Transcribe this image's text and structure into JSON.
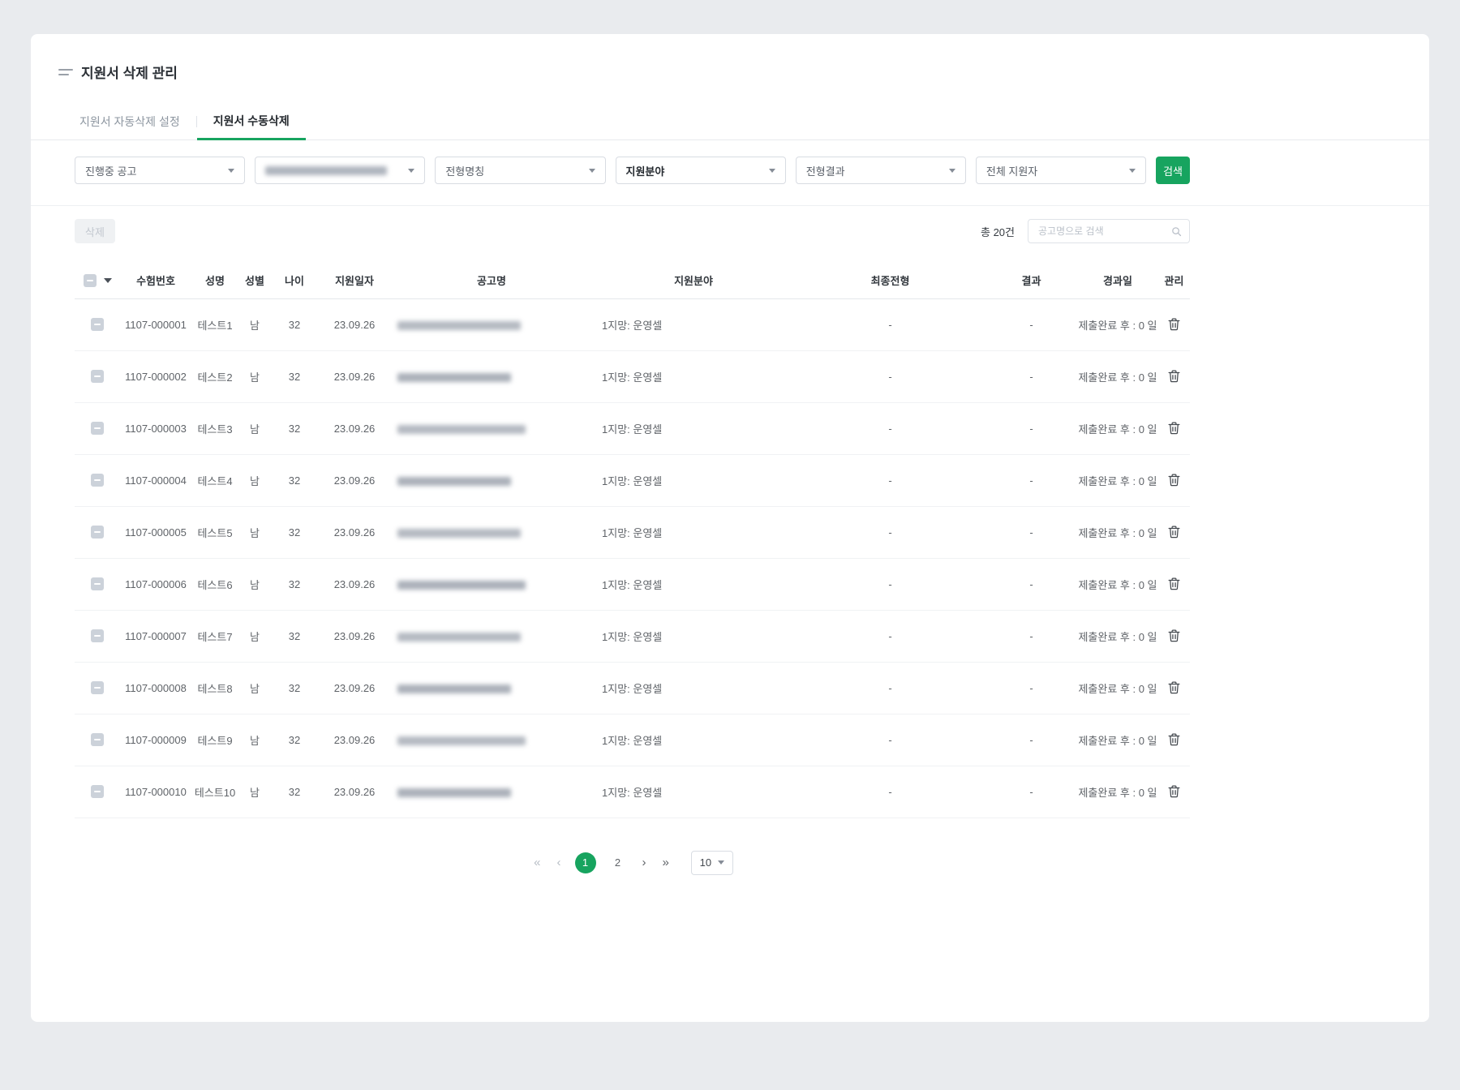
{
  "colors": {
    "accent_green": "#17a45f"
  },
  "page": {
    "title": "지원서 삭제 관리"
  },
  "tabs": [
    {
      "label": "지원서 자동삭제 설정"
    },
    {
      "label": "지원서 수동삭제"
    }
  ],
  "active_tab": 1,
  "filters": {
    "dropdowns": [
      {
        "value": "진행중 공고",
        "redacted": false,
        "emphasized": false
      },
      {
        "value": "",
        "redacted": true,
        "emphasized": false
      },
      {
        "value": "전형명칭",
        "redacted": false,
        "emphasized": false
      },
      {
        "value": "지원분야",
        "redacted": false,
        "emphasized": true
      },
      {
        "value": "전형결과",
        "redacted": false,
        "emphasized": false
      },
      {
        "value": "전체 지원자",
        "redacted": false,
        "emphasized": false
      }
    ],
    "search_button": "검색"
  },
  "toolbar": {
    "delete_button": "삭제",
    "total_label": "총 20건",
    "search_placeholder": "공고명으로 검색"
  },
  "table": {
    "columns": [
      {
        "key": "exam_no",
        "label": "수험번호"
      },
      {
        "key": "name",
        "label": "성명"
      },
      {
        "key": "gender",
        "label": "성별"
      },
      {
        "key": "age",
        "label": "나이"
      },
      {
        "key": "apply_date",
        "label": "지원일자"
      },
      {
        "key": "announcement",
        "label": "공고명"
      },
      {
        "key": "field",
        "label": "지원분야"
      },
      {
        "key": "final_stage",
        "label": "최종전형"
      },
      {
        "key": "result",
        "label": "결과"
      },
      {
        "key": "elapsed",
        "label": "경과일"
      },
      {
        "key": "manage",
        "label": "관리"
      }
    ],
    "rows": [
      {
        "exam_no": "1107-000001",
        "name": "테스트1",
        "gender": "남",
        "age": "32",
        "apply_date": "23.09.26",
        "field": "1지망: 운영셀",
        "final_stage": "-",
        "result": "-",
        "elapsed": "제출완료 후 : 0 일"
      },
      {
        "exam_no": "1107-000002",
        "name": "테스트2",
        "gender": "남",
        "age": "32",
        "apply_date": "23.09.26",
        "field": "1지망: 운영셀",
        "final_stage": "-",
        "result": "-",
        "elapsed": "제출완료 후 : 0 일"
      },
      {
        "exam_no": "1107-000003",
        "name": "테스트3",
        "gender": "남",
        "age": "32",
        "apply_date": "23.09.26",
        "field": "1지망: 운영셀",
        "final_stage": "-",
        "result": "-",
        "elapsed": "제출완료 후 : 0 일"
      },
      {
        "exam_no": "1107-000004",
        "name": "테스트4",
        "gender": "남",
        "age": "32",
        "apply_date": "23.09.26",
        "field": "1지망: 운영셀",
        "final_stage": "-",
        "result": "-",
        "elapsed": "제출완료 후 : 0 일"
      },
      {
        "exam_no": "1107-000005",
        "name": "테스트5",
        "gender": "남",
        "age": "32",
        "apply_date": "23.09.26",
        "field": "1지망: 운영셀",
        "final_stage": "-",
        "result": "-",
        "elapsed": "제출완료 후 : 0 일"
      },
      {
        "exam_no": "1107-000006",
        "name": "테스트6",
        "gender": "남",
        "age": "32",
        "apply_date": "23.09.26",
        "field": "1지망: 운영셀",
        "final_stage": "-",
        "result": "-",
        "elapsed": "제출완료 후 : 0 일"
      },
      {
        "exam_no": "1107-000007",
        "name": "테스트7",
        "gender": "남",
        "age": "32",
        "apply_date": "23.09.26",
        "field": "1지망: 운영셀",
        "final_stage": "-",
        "result": "-",
        "elapsed": "제출완료 후 : 0 일"
      },
      {
        "exam_no": "1107-000008",
        "name": "테스트8",
        "gender": "남",
        "age": "32",
        "apply_date": "23.09.26",
        "field": "1지망: 운영셀",
        "final_stage": "-",
        "result": "-",
        "elapsed": "제출완료 후 : 0 일"
      },
      {
        "exam_no": "1107-000009",
        "name": "테스트9",
        "gender": "남",
        "age": "32",
        "apply_date": "23.09.26",
        "field": "1지망: 운영셀",
        "final_stage": "-",
        "result": "-",
        "elapsed": "제출완료 후 : 0 일"
      },
      {
        "exam_no": "1107-000010",
        "name": "테스트10",
        "gender": "남",
        "age": "32",
        "apply_date": "23.09.26",
        "field": "1지망: 운영셀",
        "final_stage": "-",
        "result": "-",
        "elapsed": "제출완료 후 : 0 일"
      }
    ]
  },
  "icons": {
    "first_page": "«",
    "prev_page": "‹",
    "next_page": "›",
    "last_page": "»"
  },
  "pagination": {
    "pages": [
      "1",
      "2"
    ],
    "active_page": "1",
    "page_size": "10"
  }
}
